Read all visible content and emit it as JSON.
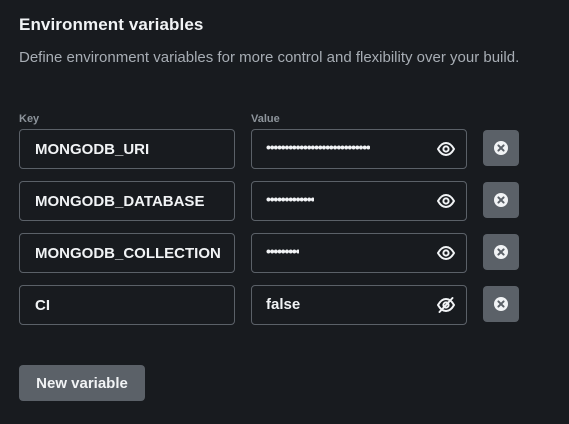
{
  "section": {
    "title": "Environment variables",
    "description": "Define environment variables for more control and flexibility over your build."
  },
  "columns": {
    "key_label": "Key",
    "value_label": "Value"
  },
  "variables": [
    {
      "key": "MONGODB_URI",
      "value_masked": "••••••••••••••••••••••••••••",
      "visible": false,
      "toggle_icon": "eye-icon"
    },
    {
      "key": "MONGODB_DATABASE",
      "value_masked": "•••••••••••••",
      "visible": false,
      "toggle_icon": "eye-icon"
    },
    {
      "key": "MONGODB_COLLECTION",
      "value_masked": "•••••••••",
      "visible": false,
      "toggle_icon": "eye-icon"
    },
    {
      "key": "CI",
      "value": "false",
      "visible": true,
      "toggle_icon": "eye-off-icon"
    }
  ],
  "actions": {
    "new_variable_label": "New variable",
    "delete_icon": "close-circle-icon"
  },
  "colors": {
    "background": "#181b1f",
    "border": "#5b6168",
    "button_bg": "#5b6168",
    "text": "#f1f3f5",
    "muted_text": "#a7adb4"
  }
}
